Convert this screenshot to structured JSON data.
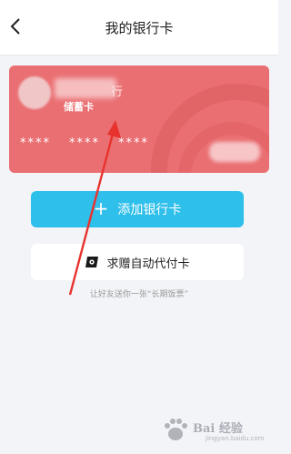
{
  "header": {
    "title": "我的银行卡",
    "back_icon": "chevron-left-icon"
  },
  "card": {
    "bank_suffix": "行",
    "type": "储蓄卡",
    "number_groups": [
      "****",
      "****",
      "****"
    ],
    "color": "#ea6f72"
  },
  "actions": {
    "add_label": "添加银行卡",
    "add_icon": "plus-icon",
    "add_color": "#2fbfeb",
    "gift_label": "求赠自动代付卡",
    "gift_icon": "card-gift-icon"
  },
  "hint": "让好友送你一张“长期饭票”",
  "watermark": {
    "text": "Bai 经验",
    "sub": "jingyan.baidu.com"
  },
  "annotation": {
    "arrow_color": "#e8322d"
  }
}
